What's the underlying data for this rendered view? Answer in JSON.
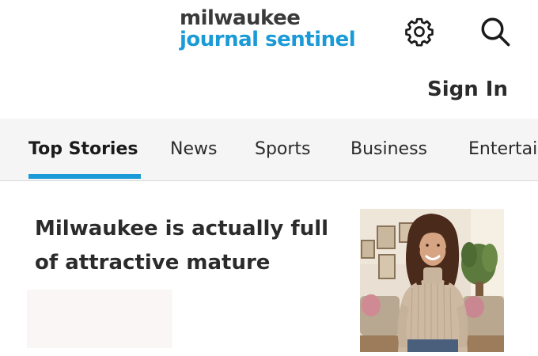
{
  "header": {
    "logo_line1": "milwaukee",
    "logo_line2": "journal sentinel",
    "signin_label": "Sign In",
    "settings_icon": "gear-icon",
    "search_icon": "search-icon"
  },
  "nav": {
    "items": [
      {
        "label": "Top Stories",
        "active": true
      },
      {
        "label": "News"
      },
      {
        "label": "Sports"
      },
      {
        "label": "Business"
      },
      {
        "label": "Entertainment"
      }
    ]
  },
  "article": {
    "headline": "Milwaukee is actually full of attractive mature women",
    "thumbnail": "woman-portrait-photo"
  },
  "colors": {
    "brand_blue": "#1a9ad6",
    "text_dark": "#2b2b2b",
    "nav_bg": "#f5f5f5"
  }
}
